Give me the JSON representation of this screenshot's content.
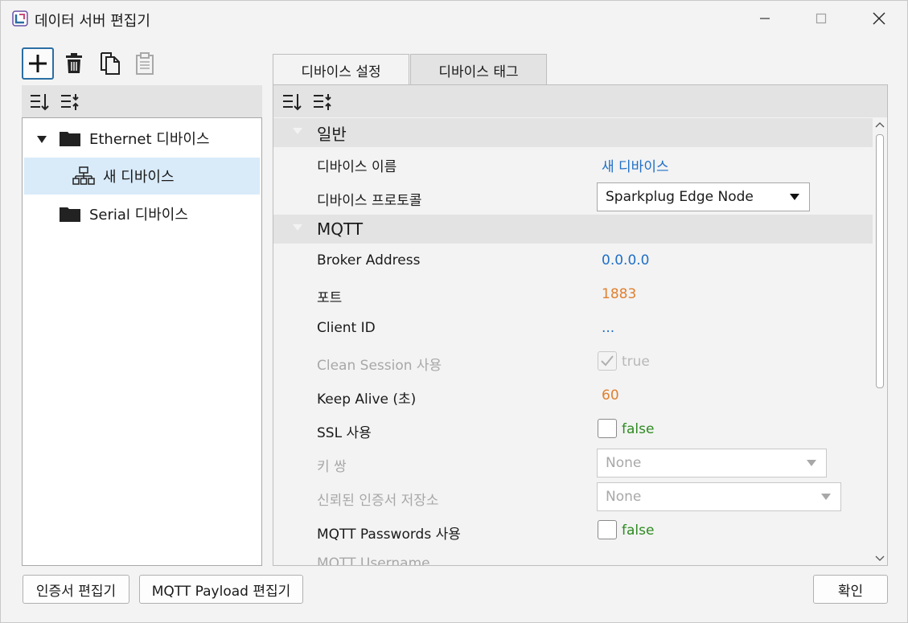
{
  "window": {
    "title": "데이터 서버 편집기"
  },
  "tree": {
    "items": [
      {
        "label": "Ethernet 디바이스"
      },
      {
        "label": "새 디바이스"
      },
      {
        "label": "Serial 디바이스"
      }
    ]
  },
  "tabs": [
    {
      "label": "디바이스 설정"
    },
    {
      "label": "디바이스 태그"
    }
  ],
  "grid": {
    "sections": [
      {
        "label": "일반"
      },
      {
        "label": "MQTT"
      }
    ],
    "rows": [
      {
        "label": "디바이스 이름",
        "value": "새 디바이스"
      },
      {
        "label": "디바이스 프로토콜",
        "value": "Sparkplug Edge Node"
      },
      {
        "label": "Broker Address",
        "value": "0.0.0.0"
      },
      {
        "label": "포트",
        "value": "1883"
      },
      {
        "label": "Client ID",
        "value": "..."
      },
      {
        "label": "Clean Session 사용",
        "value": "true"
      },
      {
        "label": "Keep Alive (초)",
        "value": "60"
      },
      {
        "label": "SSL 사용",
        "value": "false"
      },
      {
        "label": "키 쌍",
        "value": "None"
      },
      {
        "label": "신뢰된 인증서 저장소",
        "value": "None"
      },
      {
        "label": "MQTT Passwords 사용",
        "value": "false"
      },
      {
        "label": "MQTT Username",
        "value": ""
      }
    ]
  },
  "buttons": {
    "cert_editor": "인증서 편집기",
    "payload_editor": "MQTT Payload 편집기",
    "ok": "확인"
  },
  "colors": {
    "accent": "#2b6ea3",
    "value_blue": "#1f6fc6",
    "value_orange": "#e08030",
    "value_green": "#2e8b22",
    "selection": "#d9ebf9"
  }
}
